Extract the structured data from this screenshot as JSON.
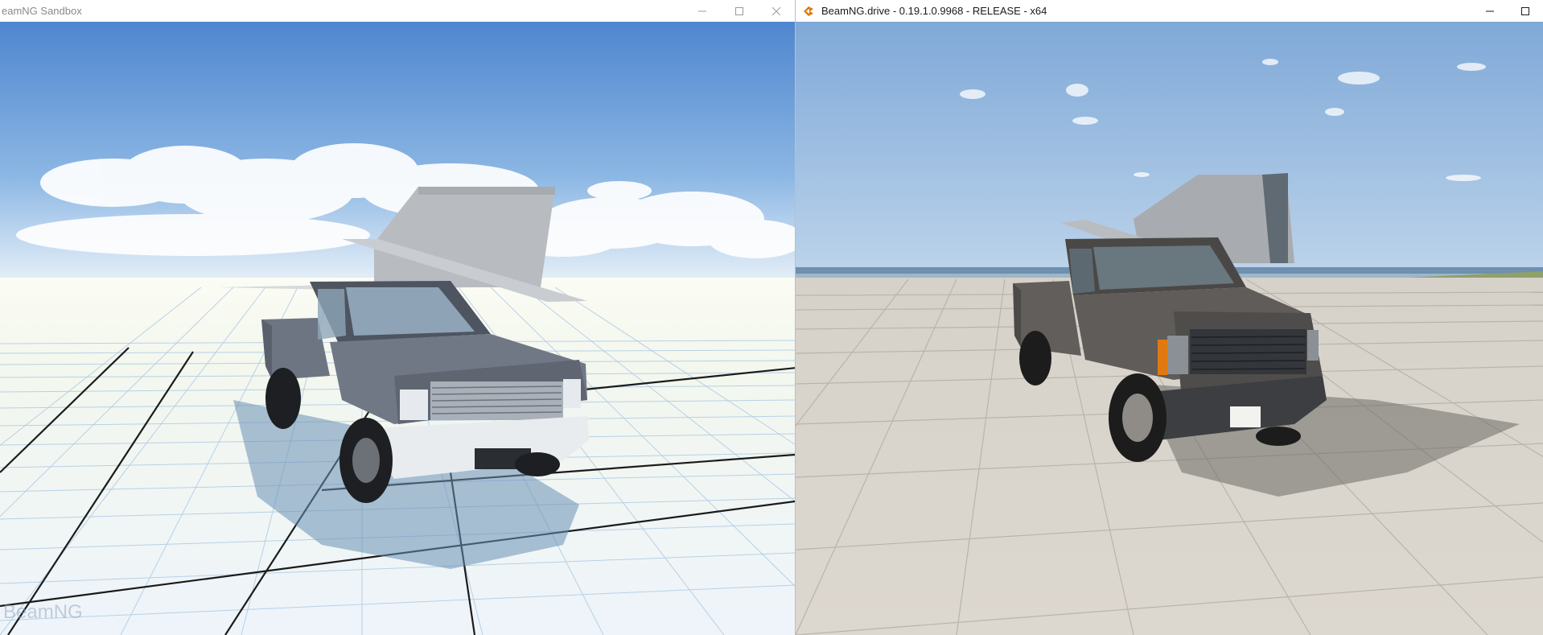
{
  "left_window": {
    "title": "eamNG Sandbox",
    "watermark": "BeamNG",
    "controls": {
      "minimize_icon": "minimize-icon",
      "maximize_icon": "maximize-icon",
      "close_icon": "close-icon"
    },
    "scene": {
      "sky_color": "#5a8fd1",
      "ground_color": "#f2f7fb",
      "grid_color": "#9cc0de",
      "truck_color": "#6d7480"
    }
  },
  "right_window": {
    "title": "BeamNG.drive - 0.19.1.0.9968 - RELEASE - x64",
    "app_icon": "beamng-drive-icon",
    "controls": {
      "minimize_icon": "minimize-icon",
      "maximize_icon": "maximize-icon"
    },
    "scene": {
      "sky_color": "#8cb3dc",
      "ground_color": "#d8d3cb",
      "truck_color": "#5e5b58",
      "accent_color": "#e07a10"
    }
  }
}
